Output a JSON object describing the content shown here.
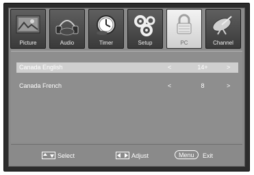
{
  "tabs": [
    {
      "label": "Picture",
      "icon": "picture-icon",
      "active": false
    },
    {
      "label": "Audio",
      "icon": "audio-icon",
      "active": false
    },
    {
      "label": "Timer",
      "icon": "timer-icon",
      "active": false
    },
    {
      "label": "Setup",
      "icon": "setup-gears-icon",
      "active": false
    },
    {
      "label": "PC",
      "icon": "lock-icon",
      "active": true
    },
    {
      "label": "Channel",
      "icon": "antenna-icon",
      "active": false
    }
  ],
  "rows": [
    {
      "name": "Canada English",
      "value": "14+",
      "selected": true
    },
    {
      "name": "Canada French",
      "value": "8",
      "selected": false
    }
  ],
  "footer": {
    "select_label": "Select",
    "adjust_label": "Adjust",
    "menu_key": "Menu",
    "exit_label": "Exit"
  },
  "arrows": {
    "left": "<",
    "right": ">"
  }
}
